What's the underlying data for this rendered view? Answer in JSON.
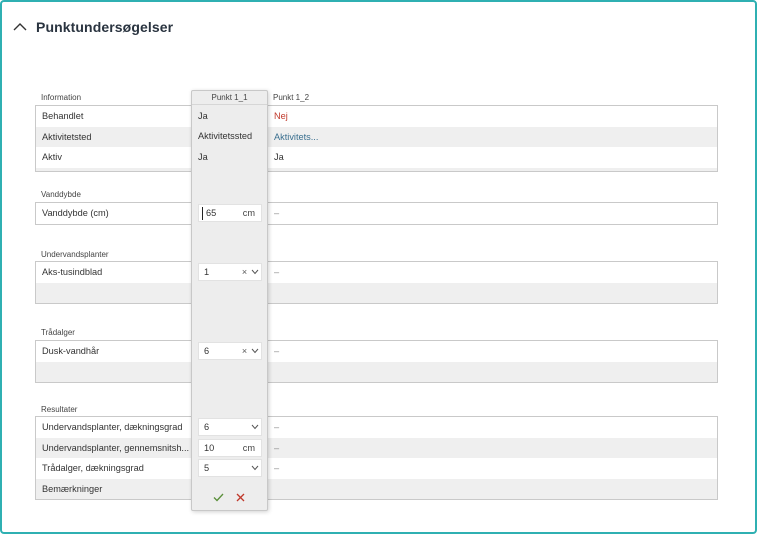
{
  "section": {
    "title": "Punktundersøgelser"
  },
  "columns": {
    "p1": "Punkt 1_1",
    "p2": "Punkt 1_2"
  },
  "information": {
    "label": "Information",
    "rows": [
      {
        "name": "Behandlet",
        "v1": "Ja",
        "v2": "Nej"
      },
      {
        "name": "Aktivitetsted",
        "v1": "Aktivitetssted",
        "v2": "Aktivitets..."
      },
      {
        "name": "Aktiv",
        "v1": "Ja",
        "v2": "Ja"
      }
    ]
  },
  "vanddybde": {
    "label": "Vanddybde",
    "row": {
      "name": "Vanddybde (cm)",
      "value": "65",
      "unit": "cm",
      "v2": "–"
    }
  },
  "undervandsplanter": {
    "label": "Undervandsplanter",
    "row": {
      "name": "Aks-tusindblad",
      "value": "1",
      "v2": "–"
    }
  },
  "traadalger": {
    "label": "Trådalger",
    "row": {
      "name": "Dusk-vandhår",
      "value": "6",
      "v2": "–"
    }
  },
  "resultater": {
    "label": "Resultater",
    "rows": [
      {
        "name": "Undervandsplanter, dækningsgrad",
        "value": "6",
        "v2": "–"
      },
      {
        "name": "Undervandsplanter, gennemsnitsh...",
        "value": "10",
        "unit": "cm",
        "v2": "–"
      },
      {
        "name": "Trådalger, dækningsgrad",
        "value": "5",
        "v2": "–"
      },
      {
        "name": "Bemærkninger",
        "value": "",
        "v2": ""
      }
    ]
  },
  "icons": {
    "collapse": "chevron-up-icon",
    "clear": "clear-x-icon",
    "dropdown": "chevron-down-icon",
    "confirm": "check-icon",
    "cancel": "close-icon"
  },
  "colors": {
    "frame": "#2fb0b2",
    "negative": "#c0392b",
    "link": "#3a6f8f",
    "confirm": "#5a8f3a",
    "cancel": "#c0392b"
  }
}
